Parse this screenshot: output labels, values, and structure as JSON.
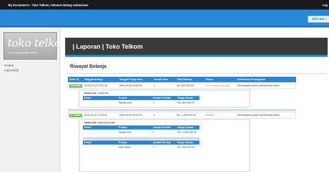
{
  "topbar": {
    "title": "My Ecommerce - Toko Telkom, Selamat datang mahasiswa",
    "user": "Log"
  },
  "header": {
    "visit_label": "Visit Site »"
  },
  "sidebar": {
    "logo_main": "toko telkom",
    "logo_sub": "pusat penjualan online",
    "items": [
      {
        "label": "Produk"
      },
      {
        "label": "Laporan(5)"
      }
    ]
  },
  "main": {
    "page_title": "| Laporan | Toko Telkom",
    "section_title": "Riwayat Belanja",
    "columns": [
      "Order ID",
      "Tanggal Belanja",
      "Tanggal Pengiriman",
      "Jumlah Item",
      "Total Belanja",
      "Status",
      "Konfirmasi Pembayaran"
    ],
    "detail_columns": [
      "Detail",
      "Produk",
      "Jumlah Produk",
      "Harga Satuan"
    ],
    "client_label": "Nama Client :",
    "orders": [
      {
        "id": "28 Detail",
        "tanggal_belanja": "2015-02-23 22:52:36",
        "tanggal_pengiriman": "0000-00-00 00:00:00",
        "jumlah_item": "1",
        "total": "Rp. 800.000.00",
        "status": "Data sedang diproses",
        "konfirmasi": "Pembayaran belum dikonfirmasi admin",
        "client": "malia siwi",
        "details": [
          {
            "produk": "Sepatu kulo",
            "jumlah": "1",
            "harga": "Rp. 800.000.00"
          }
        ]
      },
      {
        "id": "27 Detail",
        "tanggal_belanja": "2015-03-19 12:28:04",
        "tanggal_pengiriman": "0000-00-00 00:00:00",
        "jumlah_item": "3",
        "total": "Rp. 1.300.000.00",
        "status": "Selesai",
        "konfirmasi": "Pembayaran sudah dikonfirmasi admin",
        "client": "ganteng banget",
        "details": [
          {
            "produk": "Sepatu kulo",
            "jumlah": "2",
            "harga": "Rp. 1.000.000.00"
          },
          {
            "produk": "baso tama",
            "jumlah": "1",
            "harga": "Rp. 200.000.00"
          }
        ]
      }
    ]
  },
  "colors": {
    "accent": "#2a88d8",
    "badge": "#6dbf4b",
    "status_processing": "#e8912a",
    "topbar": "#1a1a1a"
  }
}
